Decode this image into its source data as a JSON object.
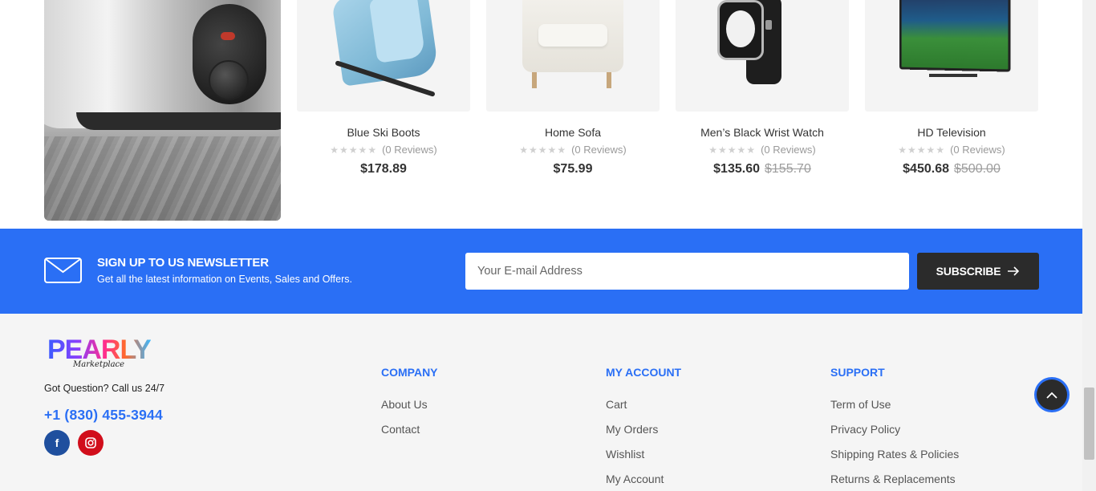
{
  "products": [
    {
      "name": "Blue Ski Boots",
      "stars": "★★★★★",
      "reviews": "(0 Reviews)",
      "price": "$178.89",
      "old_price": ""
    },
    {
      "name": "Home Sofa",
      "stars": "★★★★★",
      "reviews": "(0 Reviews)",
      "price": "$75.99",
      "old_price": ""
    },
    {
      "name": "Men’s Black Wrist Watch",
      "stars": "★★★★★",
      "reviews": "(0 Reviews)",
      "price": "$135.60",
      "old_price": "$155.70"
    },
    {
      "name": "HD Television",
      "stars": "★★★★★",
      "reviews": "(0 Reviews)",
      "price": "$450.68",
      "old_price": "$500.00"
    }
  ],
  "newsletter": {
    "title": "SIGN UP TO US NEWSLETTER",
    "subtitle": "Get all the latest information on Events, Sales and Offers.",
    "placeholder": "Your E-mail Address",
    "button_label": "SUBSCRIBE",
    "background_color": "#2a6ff5"
  },
  "footer": {
    "logo_text": "PEARLY",
    "logo_sub": "Marketplace",
    "question": "Got Question? Call us 24/7",
    "phone": "+1 (830) 455-3944",
    "social": [
      {
        "icon": "facebook-icon",
        "glyph": "f"
      },
      {
        "icon": "instagram-icon",
        "glyph": "◎"
      }
    ],
    "columns": [
      {
        "title": "COMPANY",
        "links": [
          "About Us",
          "Contact"
        ]
      },
      {
        "title": "MY ACCOUNT",
        "links": [
          "Cart",
          "My Orders",
          "Wishlist",
          "My Account"
        ]
      },
      {
        "title": "SUPPORT",
        "links": [
          "Term of Use",
          "Privacy Policy",
          "Shipping Rates & Policies",
          "Returns & Replacements"
        ]
      }
    ]
  },
  "colors": {
    "accent": "#2a6ff5",
    "dark": "#2b2b2b"
  }
}
